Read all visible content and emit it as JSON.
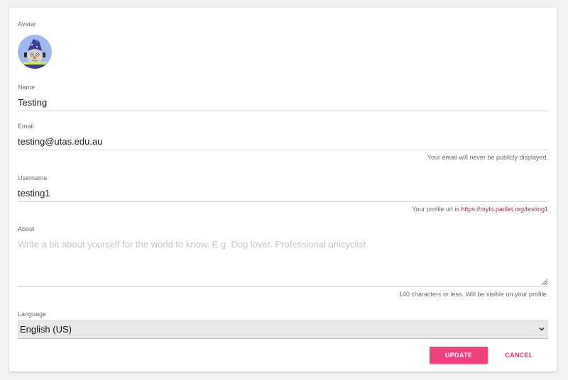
{
  "avatar": {
    "label": "Avatar",
    "icon": "wizard-avatar-icon",
    "bg_color": "#9fb8f0"
  },
  "name": {
    "label": "Name",
    "value": "Testing"
  },
  "email": {
    "label": "Email",
    "value": "testing@utas.edu.au",
    "hint": "Your email will never be publicly displayed."
  },
  "username": {
    "label": "Username",
    "value": "testing1",
    "hint_prefix": "Your profile url is ",
    "hint_link": "https://mylo.padlet.org/testing1"
  },
  "about": {
    "label": "About",
    "value": "",
    "placeholder": "Write a bit about yourself for the world to know. E.g. Dog lover. Professional unicyclist.",
    "hint": "140 characters or less. Will be visible on your profile."
  },
  "language": {
    "label": "Language",
    "selected": "English (US)"
  },
  "actions": {
    "update_label": "UPDATE",
    "cancel_label": "CANCEL"
  },
  "colors": {
    "accent": "#f0407e",
    "link": "#c2185b",
    "cancel_text": "#e0336f"
  }
}
